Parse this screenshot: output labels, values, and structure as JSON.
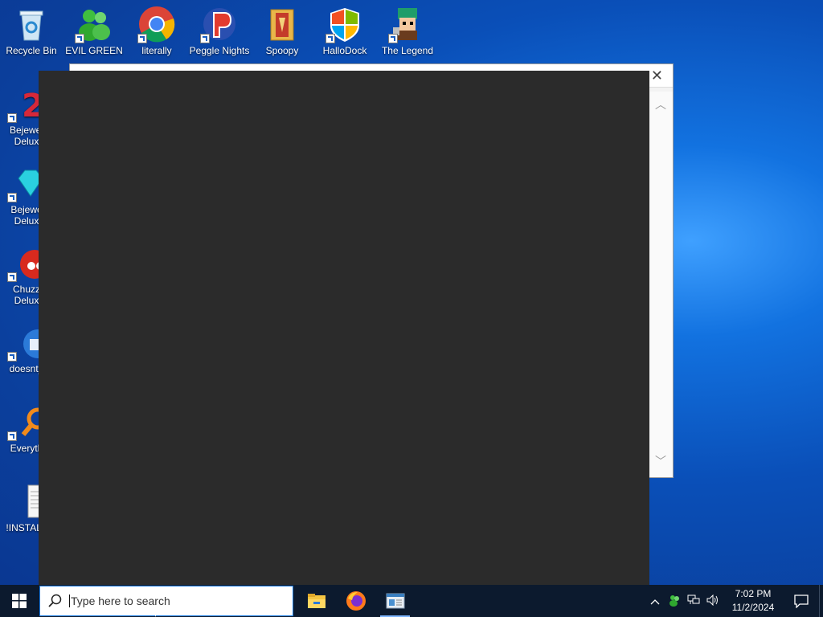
{
  "desktop": {
    "icons_top": [
      {
        "label": "Recycle Bin",
        "icon": "recycle-bin-icon"
      },
      {
        "label": "EVIL GREEN",
        "icon": "msn-messenger-icon"
      },
      {
        "label": "literally",
        "icon": "chrome-icon"
      },
      {
        "label": "Peggle Nights",
        "icon": "peggle-icon"
      },
      {
        "label": "Spoopy",
        "icon": "spoopy-folder-icon"
      },
      {
        "label": "HalloDock",
        "icon": "windows-logo-icon"
      },
      {
        "label": "The Legend",
        "icon": "zelda-character-icon"
      }
    ],
    "icons_left": [
      {
        "label": "Bejewel",
        "label2": "Delux",
        "icon": "bejeweled2-icon"
      },
      {
        "label": "Bejewe",
        "label2": "Delux",
        "icon": "bejeweled-gem-icon"
      },
      {
        "label": "Chuzz",
        "label2": "Delux",
        "icon": "chuzzle-icon"
      },
      {
        "label": "doesnt_",
        "label2": "",
        "icon": "thunderbird-icon"
      },
      {
        "label": "Everyth",
        "label2": "",
        "icon": "everything-search-icon"
      },
      {
        "label": "!INSTALL",
        "label2": "",
        "icon": "text-document-icon"
      }
    ]
  },
  "dialog": {
    "close_glyph": "✕",
    "scroll_up": "︿",
    "scroll_down": "﹀"
  },
  "taskbar": {
    "search_placeholder": "Type here to search",
    "apps": [
      {
        "name": "file-explorer-icon"
      },
      {
        "name": "firefox-icon"
      },
      {
        "name": "app-window-icon",
        "active": true
      }
    ],
    "clock_time": "7:02 PM",
    "clock_date": "11/2/2024"
  },
  "colors": {
    "taskbar": "#0c1a2e",
    "dark_window": "#2b2b2b",
    "accent": "#1d7be0"
  }
}
